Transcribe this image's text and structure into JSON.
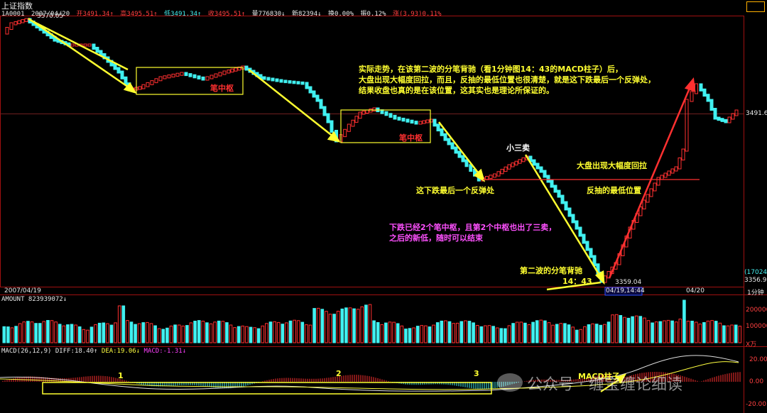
{
  "window": {
    "title": "上证指数",
    "code": "1A0001",
    "date": "2007/04/20"
  },
  "quote": {
    "open": "开3491.34↑",
    "high": "高3495.51↑",
    "low": "低3491.34↑",
    "close": "收3495.51↑",
    "volume": "量776830↓",
    "new": "新82394↓",
    "turnover": "换0.00%",
    "amplitude": "振0.12%",
    "change": "涨(3.93)0.11%"
  },
  "price_labels": {
    "top": "3570.05",
    "right_mid": "3491.6",
    "bottom_low": "3359.04",
    "right_bottom1": "(17024)",
    "right_bottom2": "3356.91"
  },
  "time_axis": {
    "left_date": "2007/04/19",
    "cursor": "04/19,14:44",
    "right_date": "04/20",
    "period": "1分钟"
  },
  "amount_panel": {
    "header": "AMOUNT 823939072↓",
    "ticks": [
      "200000",
      "100000",
      "X万"
    ]
  },
  "macd_panel": {
    "header_params": "MACD(26,12,9)",
    "diff": "DIFF:18.40↑",
    "dea": "DEA:19.06↓",
    "macd": "MACD:-1.31↓",
    "ticks": [
      "20.00",
      "0.00",
      "-20.00"
    ],
    "markers": [
      "1",
      "2",
      "3"
    ],
    "macd_label": "MACD柱子"
  },
  "annotations": {
    "main_lines": [
      "实际走势，在该第二波的分笔背驰（看1分钟图14：43的MACD柱子）后，",
      "大盘出现大幅度回拉，而且，反抽的最低位置也很清楚，就是这下跌最后一个反弹处，",
      "结果收盘也真的是在该位置，这其实也是理论所保证的。"
    ],
    "center1": "笔中枢",
    "center2": "笔中枢",
    "small_third_sell": "小三卖",
    "last_rebound": "这下跌最后一个反弹处",
    "big_pullback": "大盘出现大幅度回拉",
    "rebound_low": "反抽的最低位置",
    "second_wave": "第二波的分笔背驰",
    "time_1443": "14：43",
    "pink_lines": [
      "下跌已经2个笔中枢，且第2个中枢也出了三卖，",
      "之后的新低，随时可以结束"
    ]
  },
  "watermark": "公众号 · 缠宝缠论细读",
  "colors": {
    "up": "#ff3030",
    "down": "#40f0f0",
    "annotation": "#ffff30",
    "box": "#ffff30",
    "pink": "#ff50ff",
    "panelBorder": "#a01010"
  }
}
